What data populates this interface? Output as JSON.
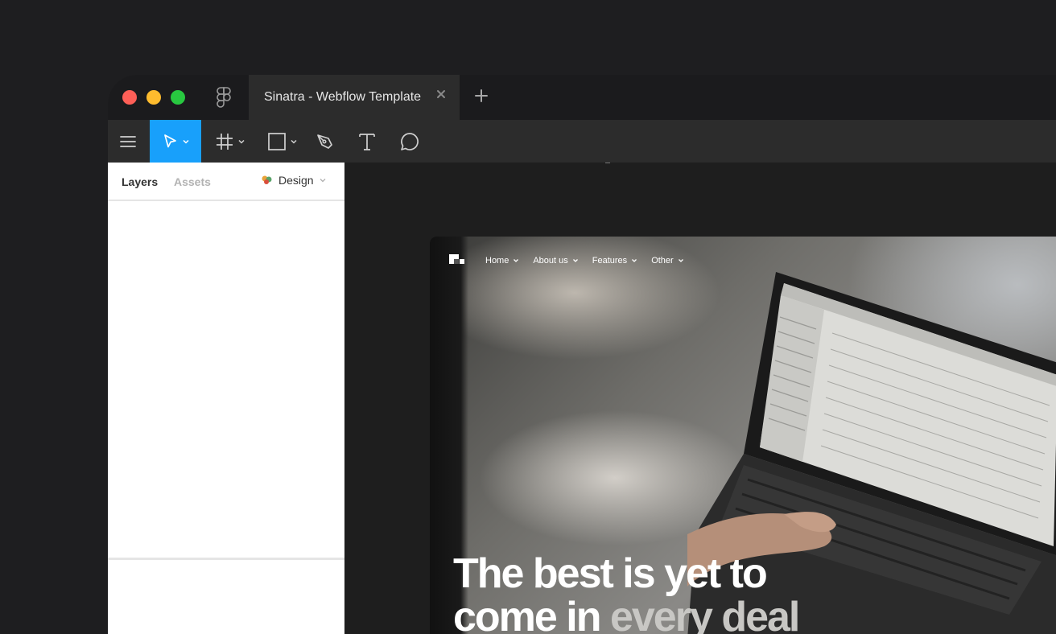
{
  "titlebar": {
    "tab_title": "Sinatra - Webflow Template"
  },
  "toolbar": {
    "tools": [
      "menu-icon",
      "move-tool",
      "frame-tool",
      "shape-tool",
      "pen-tool",
      "text-tool",
      "comment-tool"
    ],
    "active_tool": "move-tool",
    "accent_color": "#18a0fb"
  },
  "left_panel": {
    "tabs": [
      {
        "label": "Layers",
        "active": true
      },
      {
        "label": "Assets",
        "active": false
      }
    ],
    "page_select": "Design"
  },
  "site": {
    "nav": [
      {
        "label": "Home"
      },
      {
        "label": "About us"
      },
      {
        "label": "Features"
      },
      {
        "label": "Other"
      }
    ],
    "hero_line1": "The best is yet to",
    "hero_line2_a": "come in",
    "hero_line2_b": "every deal"
  }
}
